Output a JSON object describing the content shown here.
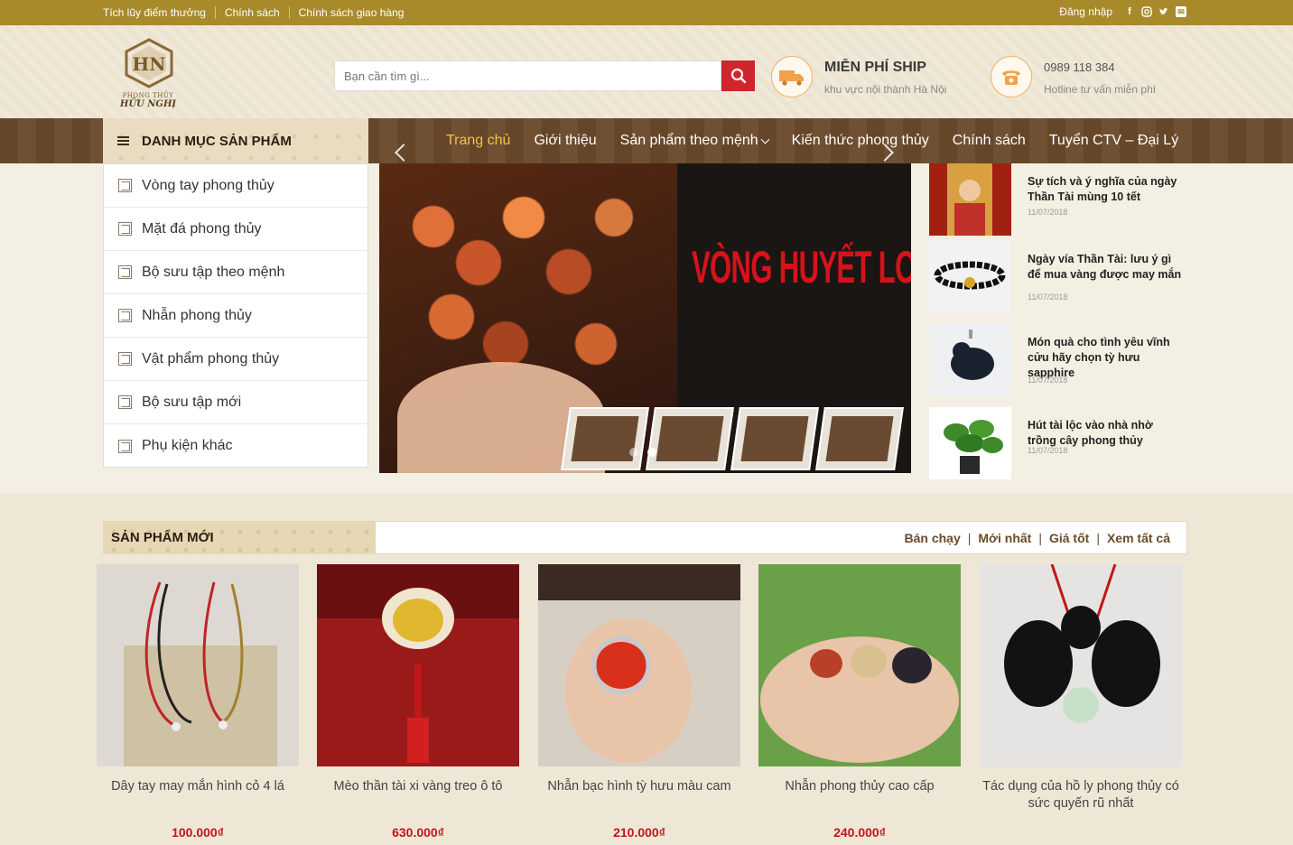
{
  "topbar": {
    "links": [
      "Tích lũy điểm thưởng",
      "Chính sách",
      "Chính sách giao hàng"
    ],
    "login": "Đăng nhập",
    "social_icons": [
      "facebook-icon",
      "instagram-icon",
      "twitter-icon",
      "email-icon"
    ]
  },
  "logo": {
    "subtitle": "PHONG THỦY",
    "brand": "HỮU NGHỊ"
  },
  "search": {
    "placeholder": "Bạn cần tìm gì..."
  },
  "shipping": {
    "title": "MIỄN PHÍ SHIP",
    "subtitle": "khu vực nội thành Hà Nội"
  },
  "hotline": {
    "phone": "0989 118 384",
    "subtitle": "Hotline tư vấn miễn phí"
  },
  "nav": {
    "category_button": "DANH MỤC SẢN PHẨM",
    "items": [
      {
        "label": "Trang chủ",
        "active": true
      },
      {
        "label": "Giới thiệu"
      },
      {
        "label": "Sản phẩm theo mệnh",
        "dropdown": true
      },
      {
        "label": "Kiến thức phong thủy"
      },
      {
        "label": "Chính sách"
      },
      {
        "label": "Tuyển CTV – Đại Lý"
      }
    ]
  },
  "categories": [
    "Vòng tay phong thủy",
    "Mặt đá phong thủy",
    "Bộ sưu tập theo mệnh",
    "Nhẫn phong thủy",
    "Vật phẩm phong thủy",
    "Bộ sưu tập mới",
    "Phụ kiện khác"
  ],
  "slider": {
    "title": "VÒNG HUYẾT LONG",
    "slides": 2,
    "active_slide": 2
  },
  "news": [
    {
      "title": "Sự tích và ý nghĩa của ngày Thần Tài mùng 10 tết",
      "date": "11/07/2018"
    },
    {
      "title": "Ngày vía Thần Tài: lưu ý gì để mua vàng được may mắn",
      "date": "11/07/2018"
    },
    {
      "title": "Món quà cho tình yêu vĩnh cửu hãy chọn tỳ hưu sapphire",
      "date": "11/07/2018"
    },
    {
      "title": "Hút tài lộc vào nhà nhờ trồng cây phong thủy",
      "date": "11/07/2018"
    }
  ],
  "products_section": {
    "title": "SẢN PHẨM MỚI",
    "filters": [
      "Bán chạy",
      "Mới nhất",
      "Giá tốt",
      "Xem tất cả"
    ]
  },
  "products": [
    {
      "name": "Dây tay may mắn hình cỏ 4 lá",
      "price": "100.000₫"
    },
    {
      "name": "Mèo thần tài xi vàng treo ô tô",
      "price": "630.000₫"
    },
    {
      "name": "Nhẫn bạc hình tỳ hưu màu cam",
      "price": "210.000₫"
    },
    {
      "name": "Nhẫn phong thủy cao cấp",
      "price": "240.000₫"
    },
    {
      "name": "Tác dụng của hồ ly phong thủy có sức quyến rũ nhất",
      "price": ""
    }
  ],
  "colors": {
    "topbar": "#a88a2a",
    "nav": "#6b4a2b",
    "accent_red": "#d0252c",
    "price_red": "#c0161c",
    "active_nav": "#f1c04a"
  }
}
